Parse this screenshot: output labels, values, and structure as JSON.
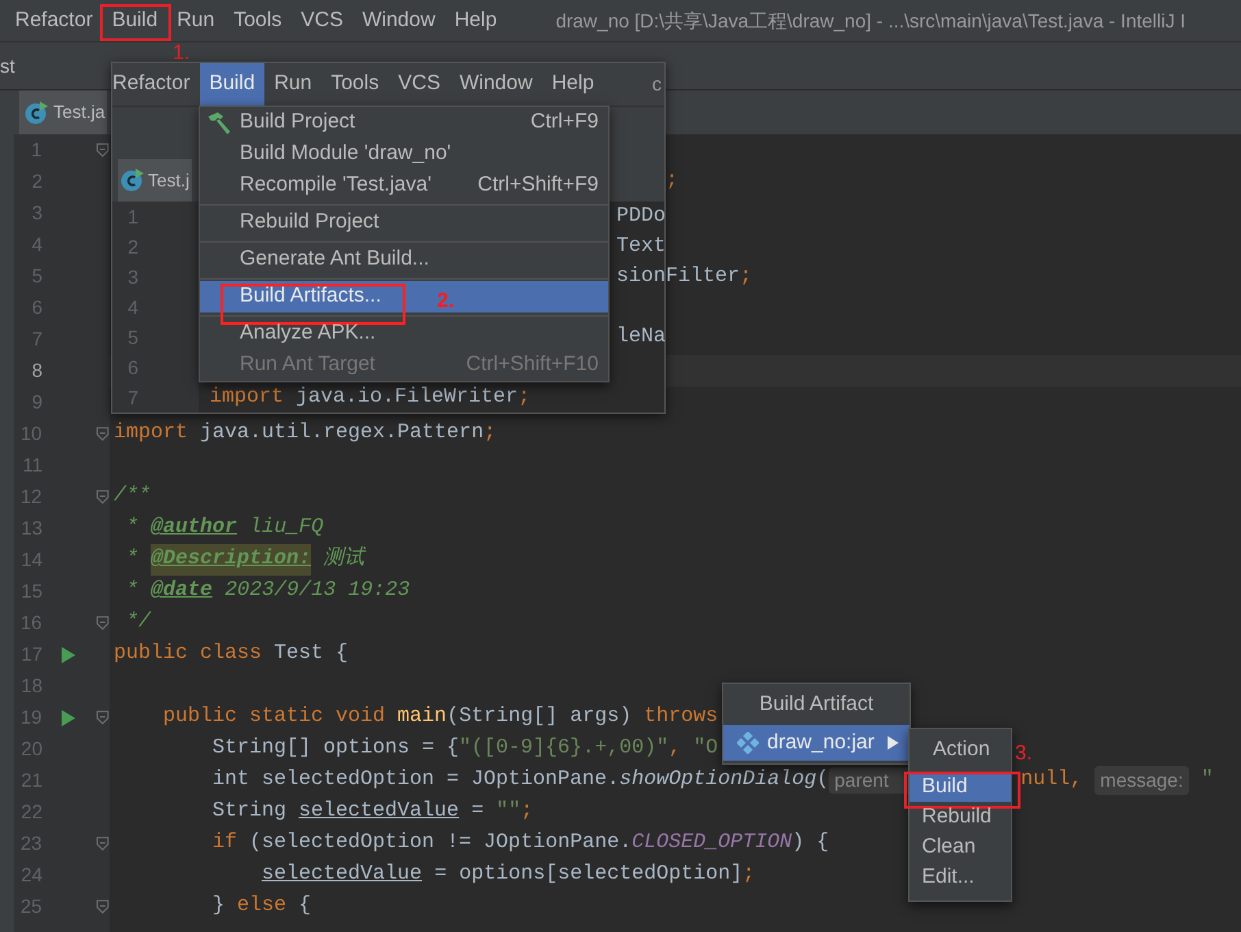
{
  "menubar": {
    "items": [
      {
        "label": "Refactor",
        "selected": false
      },
      {
        "label": "Build",
        "selected": false,
        "annotation": "1."
      },
      {
        "label": "Run",
        "selected": false
      },
      {
        "label": "Tools",
        "selected": false
      },
      {
        "label": "VCS",
        "selected": false
      },
      {
        "label": "Window",
        "selected": false
      },
      {
        "label": "Help",
        "selected": false
      }
    ],
    "title": "draw_no [D:\\共享\\Java工程\\draw_no] - ...\\src\\main\\java\\Test.java - IntelliJ I"
  },
  "toolbar": {
    "text": "st"
  },
  "tabs": [
    {
      "label": "Test.ja",
      "selected": true
    }
  ],
  "editor": {
    "lines": [
      {
        "number": "1",
        "kind": "full",
        "run": false,
        "fold": true,
        "current": false
      },
      {
        "number": "2",
        "kind": "tail",
        "run": false,
        "fold": false,
        "current": false,
        "code": [
          {
            "kind": "kw",
            "text": ";"
          }
        ]
      },
      {
        "number": "3",
        "kind": "full",
        "run": false,
        "fold": false,
        "current": false
      },
      {
        "number": "4",
        "kind": "full",
        "run": false,
        "fold": false,
        "current": false
      },
      {
        "number": "5",
        "kind": "full",
        "run": false,
        "fold": false,
        "current": false
      },
      {
        "number": "6",
        "kind": "full",
        "run": false,
        "fold": false,
        "current": false
      },
      {
        "number": "7",
        "kind": "full",
        "run": false,
        "fold": false,
        "current": false
      },
      {
        "number": "8",
        "kind": "full",
        "run": false,
        "fold": false,
        "current": true
      },
      {
        "number": "9",
        "kind": "full",
        "run": false,
        "fold": false,
        "current": false
      },
      {
        "number": "10",
        "kind": "full",
        "run": false,
        "fold": true,
        "current": false,
        "code": [
          {
            "kind": "kw",
            "text": "import"
          },
          {
            "kind": "plain",
            "text": " java.util.regex.Pattern"
          },
          {
            "kind": "kw",
            "text": ";"
          }
        ]
      },
      {
        "number": "11",
        "kind": "full",
        "run": false,
        "fold": false,
        "current": false
      },
      {
        "number": "12",
        "kind": "full",
        "run": false,
        "fold": true,
        "current": false,
        "code": [
          {
            "kind": "doc",
            "text": "/**"
          }
        ]
      },
      {
        "number": "13",
        "kind": "full",
        "run": false,
        "fold": false,
        "current": false,
        "code": [
          {
            "kind": "doc",
            "text": " * "
          },
          {
            "kind": "doctag",
            "text": "@author"
          },
          {
            "kind": "doc",
            "text": " liu_FQ"
          }
        ]
      },
      {
        "number": "14",
        "kind": "full",
        "run": false,
        "fold": false,
        "current": false,
        "code": [
          {
            "kind": "doc",
            "text": " * "
          },
          {
            "kind": "doctaghl",
            "text": "@Description:"
          },
          {
            "kind": "doc",
            "text": " 测试"
          }
        ]
      },
      {
        "number": "15",
        "kind": "full",
        "run": false,
        "fold": false,
        "current": false,
        "code": [
          {
            "kind": "doc",
            "text": " * "
          },
          {
            "kind": "doctag",
            "text": "@date"
          },
          {
            "kind": "doc",
            "text": " 2023/9/13 19:23"
          }
        ]
      },
      {
        "number": "16",
        "kind": "full",
        "run": false,
        "fold": true,
        "current": false,
        "code": [
          {
            "kind": "doc",
            "text": " */"
          }
        ]
      },
      {
        "number": "17",
        "kind": "full",
        "run": true,
        "fold": false,
        "current": false,
        "code": [
          {
            "kind": "kw",
            "text": "public class "
          },
          {
            "kind": "plain",
            "text": "Test {"
          }
        ]
      },
      {
        "number": "18",
        "kind": "full",
        "run": false,
        "fold": false,
        "current": false
      },
      {
        "number": "19",
        "kind": "full",
        "run": true,
        "fold": true,
        "current": false,
        "code": [
          {
            "kind": "kw",
            "text": "    public static void "
          },
          {
            "kind": "method",
            "text": "main"
          },
          {
            "kind": "plain",
            "text": "(String[] args) "
          },
          {
            "kind": "kw",
            "text": "throws"
          }
        ]
      },
      {
        "number": "20",
        "kind": "full",
        "run": false,
        "fold": false,
        "current": false,
        "code": [
          {
            "kind": "plain",
            "text": "        String[] options = {"
          },
          {
            "kind": "str",
            "text": "\"([0-9]{6}.+,00)\""
          },
          {
            "kind": "kw",
            "text": ", "
          },
          {
            "kind": "str",
            "text": "\"O"
          }
        ]
      },
      {
        "number": "21",
        "kind": "full",
        "run": false,
        "fold": false,
        "current": false,
        "code": [
          {
            "kind": "plain",
            "text": "        int selectedOption = JOptionPane."
          },
          {
            "kind": "italic",
            "text": "showOptionDialog"
          },
          {
            "kind": "plain",
            "text": "("
          },
          {
            "kind": "hintcut",
            "text": "parent"
          },
          {
            "kind": "kw",
            "text": " null, "
          },
          {
            "kind": "hint",
            "text": "message:"
          },
          {
            "kind": "str",
            "text": " \""
          }
        ]
      },
      {
        "number": "22",
        "kind": "full",
        "run": false,
        "fold": false,
        "current": false,
        "code": [
          {
            "kind": "plain",
            "text": "        String "
          },
          {
            "kind": "var",
            "text": "selectedValue"
          },
          {
            "kind": "plain",
            "text": " = "
          },
          {
            "kind": "str",
            "text": "\"\""
          },
          {
            "kind": "kw",
            "text": ";"
          }
        ]
      },
      {
        "number": "23",
        "kind": "full",
        "run": false,
        "fold": true,
        "current": false,
        "code": [
          {
            "kind": "kw",
            "text": "        if "
          },
          {
            "kind": "plain",
            "text": "(selectedOption != JOptionPane."
          },
          {
            "kind": "const",
            "text": "CLOSED_OPTION"
          },
          {
            "kind": "plain",
            "text": ") {"
          }
        ]
      },
      {
        "number": "24",
        "kind": "full",
        "run": false,
        "fold": false,
        "current": false,
        "code": [
          {
            "kind": "var",
            "text": "            selectedValue"
          },
          {
            "kind": "plain",
            "text": " = options[selectedOption]"
          },
          {
            "kind": "kw",
            "text": ";"
          }
        ]
      },
      {
        "number": "25",
        "kind": "full",
        "run": false,
        "fold": true,
        "current": false,
        "code": [
          {
            "kind": "plain",
            "text": "        } "
          },
          {
            "kind": "kw",
            "text": "else "
          },
          {
            "kind": "plain",
            "text": "{"
          }
        ]
      }
    ]
  },
  "embedded_screenshot": {
    "menubar": {
      "items": [
        {
          "label": "Refactor",
          "selected": false
        },
        {
          "label": "Build",
          "selected": true
        },
        {
          "label": "Run",
          "selected": false
        },
        {
          "label": "Tools",
          "selected": false
        },
        {
          "label": "VCS",
          "selected": false
        },
        {
          "label": "Window",
          "selected": false
        },
        {
          "label": "Help",
          "selected": false
        }
      ],
      "title": "c"
    },
    "tabs": [
      {
        "label": "Test.j",
        "selected": true
      }
    ],
    "lines": [
      {
        "number": "1",
        "kind": "tail",
        "code": [
          {
            "kind": "plain",
            "text": "PDDo"
          }
        ]
      },
      {
        "number": "2",
        "kind": "tail",
        "code": [
          {
            "kind": "plain",
            "text": "Text"
          }
        ]
      },
      {
        "number": "3",
        "kind": "tail",
        "code": [
          {
            "kind": "plain",
            "text": "sionFilter"
          },
          {
            "kind": "kw",
            "text": ";"
          }
        ]
      },
      {
        "number": "4",
        "kind": "tail"
      },
      {
        "number": "5",
        "kind": "tail",
        "code": [
          {
            "kind": "plain",
            "text": "leNa"
          }
        ]
      },
      {
        "number": "6",
        "kind": "tail"
      },
      {
        "number": "7",
        "kind": "full",
        "code": [
          {
            "kind": "kw",
            "text": "import"
          },
          {
            "kind": "plain",
            "text": " java.io.FileWriter"
          },
          {
            "kind": "kw",
            "text": ";"
          }
        ]
      }
    ],
    "build_menu": {
      "items": [
        {
          "kind": "item",
          "label": "Build Project",
          "shortcut": "Ctrl+F9",
          "selected": false,
          "disabled": false
        },
        {
          "kind": "item",
          "label": "Build Module 'draw_no'",
          "selected": false,
          "disabled": false
        },
        {
          "kind": "item",
          "label": "Recompile 'Test.java'",
          "shortcut": "Ctrl+Shift+F9",
          "selected": false,
          "disabled": false
        },
        {
          "kind": "separator"
        },
        {
          "kind": "item",
          "label": "Rebuild Project",
          "selected": false,
          "disabled": false
        },
        {
          "kind": "separator"
        },
        {
          "kind": "item",
          "label": "Generate Ant Build...",
          "selected": false,
          "disabled": false
        },
        {
          "kind": "separator"
        },
        {
          "kind": "item",
          "label": "Build Artifacts...",
          "selected": true,
          "disabled": false,
          "annotation": "2."
        },
        {
          "kind": "separator"
        },
        {
          "kind": "item",
          "label": "Analyze APK...",
          "selected": false,
          "disabled": false
        },
        {
          "kind": "item",
          "label": "Run Ant Target",
          "shortcut": "Ctrl+Shift+F10",
          "selected": false,
          "disabled": true
        }
      ]
    }
  },
  "build_artifact_popup": {
    "title": "Build Artifact",
    "items": [
      {
        "label": "draw_no:jar",
        "selected": true,
        "has_submenu": true
      }
    ]
  },
  "action_popup": {
    "title": "Action",
    "items": [
      {
        "label": "Build",
        "selected": true,
        "annotation": "3."
      },
      {
        "label": "Rebuild",
        "selected": false
      },
      {
        "label": "Clean",
        "selected": false
      },
      {
        "label": "Edit...",
        "selected": false
      }
    ]
  }
}
